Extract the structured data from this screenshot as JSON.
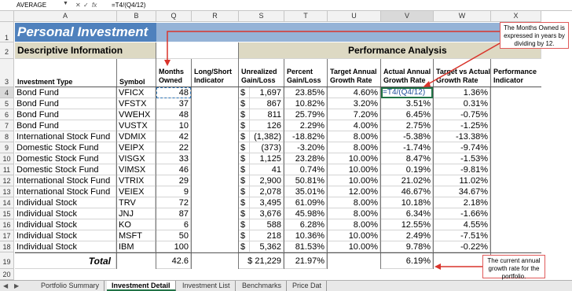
{
  "formula_bar": {
    "name_box": "AVERAGE",
    "cancel": "✕",
    "enter": "✓",
    "fx": "fx",
    "formula": "=T4/(Q4/12)"
  },
  "columns": [
    "A",
    "B",
    "Q",
    "R",
    "S",
    "T",
    "U",
    "V",
    "W",
    "X"
  ],
  "rows": [
    "1",
    "2",
    "3",
    "4",
    "5",
    "6",
    "7",
    "8",
    "9",
    "10",
    "11",
    "12",
    "13",
    "14",
    "15",
    "16",
    "17",
    "18",
    "19",
    "20"
  ],
  "title": "Personal Investment",
  "sections": {
    "descriptive": "Descriptive Information",
    "performance": "Performance Analysis"
  },
  "headers": {
    "investment_type": "Investment Type",
    "symbol": "Symbol",
    "months_owned": "Months Owned",
    "long_short": "Long/Short Indicator",
    "unrealized": "Unrealized Gain/Loss",
    "percent": "Percent Gain/Loss",
    "target_annual": "Target Annual Growth Rate",
    "actual_annual": "Actual Annual Growth Rate",
    "target_vs_actual": "Target vs Actual Growth Rate",
    "performance": "Performance Indicator"
  },
  "data_rows": [
    {
      "type": "Bond Fund",
      "symbol": "VFICX",
      "months": "48",
      "dollar": "$",
      "gain": "1,697",
      "pct": "23.85%",
      "target": "4.60%",
      "actual": "=T4/(Q4/12)",
      "diff": "1.36%"
    },
    {
      "type": "Bond Fund",
      "symbol": "VFSTX",
      "months": "37",
      "dollar": "$",
      "gain": "867",
      "pct": "10.82%",
      "target": "3.20%",
      "actual": "3.51%",
      "diff": "0.31%"
    },
    {
      "type": "Bond Fund",
      "symbol": "VWEHX",
      "months": "48",
      "dollar": "$",
      "gain": "811",
      "pct": "25.79%",
      "target": "7.20%",
      "actual": "6.45%",
      "diff": "-0.75%"
    },
    {
      "type": "Bond Fund",
      "symbol": "VUSTX",
      "months": "10",
      "dollar": "$",
      "gain": "126",
      "pct": "2.29%",
      "target": "4.00%",
      "actual": "2.75%",
      "diff": "-1.25%"
    },
    {
      "type": "International Stock Fund",
      "symbol": "VDMIX",
      "months": "42",
      "dollar": "$",
      "gain": "(1,382)",
      "pct": "-18.82%",
      "target": "8.00%",
      "actual": "-5.38%",
      "diff": "-13.38%"
    },
    {
      "type": "Domestic Stock Fund",
      "symbol": "VEIPX",
      "months": "22",
      "dollar": "$",
      "gain": "(373)",
      "pct": "-3.20%",
      "target": "8.00%",
      "actual": "-1.74%",
      "diff": "-9.74%"
    },
    {
      "type": "Domestic Stock Fund",
      "symbol": "VISGX",
      "months": "33",
      "dollar": "$",
      "gain": "1,125",
      "pct": "23.28%",
      "target": "10.00%",
      "actual": "8.47%",
      "diff": "-1.53%"
    },
    {
      "type": "Domestic Stock Fund",
      "symbol": "VIMSX",
      "months": "46",
      "dollar": "$",
      "gain": "41",
      "pct": "0.74%",
      "target": "10.00%",
      "actual": "0.19%",
      "diff": "-9.81%"
    },
    {
      "type": "International Stock Fund",
      "symbol": "VTRIX",
      "months": "29",
      "dollar": "$",
      "gain": "2,900",
      "pct": "50.81%",
      "target": "10.00%",
      "actual": "21.02%",
      "diff": "11.02%"
    },
    {
      "type": "International Stock Fund",
      "symbol": "VEIEX",
      "months": "9",
      "dollar": "$",
      "gain": "2,078",
      "pct": "35.01%",
      "target": "12.00%",
      "actual": "46.67%",
      "diff": "34.67%"
    },
    {
      "type": "Individual Stock",
      "symbol": "TRV",
      "months": "72",
      "dollar": "$",
      "gain": "3,495",
      "pct": "61.09%",
      "target": "8.00%",
      "actual": "10.18%",
      "diff": "2.18%"
    },
    {
      "type": "Individual Stock",
      "symbol": "JNJ",
      "months": "87",
      "dollar": "$",
      "gain": "3,676",
      "pct": "45.98%",
      "target": "8.00%",
      "actual": "6.34%",
      "diff": "-1.66%"
    },
    {
      "type": "Individual Stock",
      "symbol": "KO",
      "months": "6",
      "dollar": "$",
      "gain": "588",
      "pct": "6.28%",
      "target": "8.00%",
      "actual": "12.55%",
      "diff": "4.55%"
    },
    {
      "type": "Individual Stock",
      "symbol": "MSFT",
      "months": "50",
      "dollar": "$",
      "gain": "218",
      "pct": "10.36%",
      "target": "10.00%",
      "actual": "2.49%",
      "diff": "-7.51%"
    },
    {
      "type": "Individual Stock",
      "symbol": "IBM",
      "months": "100",
      "dollar": "$",
      "gain": "5,362",
      "pct": "81.53%",
      "target": "10.00%",
      "actual": "9.78%",
      "diff": "-0.22%"
    }
  ],
  "totals": {
    "label": "Total",
    "months": "42.6",
    "gain": "$ 21,229",
    "pct": "21.97%",
    "actual": "6.19%"
  },
  "callouts": {
    "months_note": "The Months Owned is expressed in years by dividing by 12.",
    "rate_note": "The current annual growth rate for the portfolio."
  },
  "tabs": [
    "Portfolio Summary",
    "Investment Detail",
    "Investment List",
    "Benchmarks",
    "Price Dat"
  ],
  "active_tab": "Investment Detail",
  "colors": {
    "accent": "#4f81bd",
    "band": "#95b3d7",
    "tan": "#ddd9c3",
    "callout_border": "#e05a5a",
    "select": "#217346"
  }
}
